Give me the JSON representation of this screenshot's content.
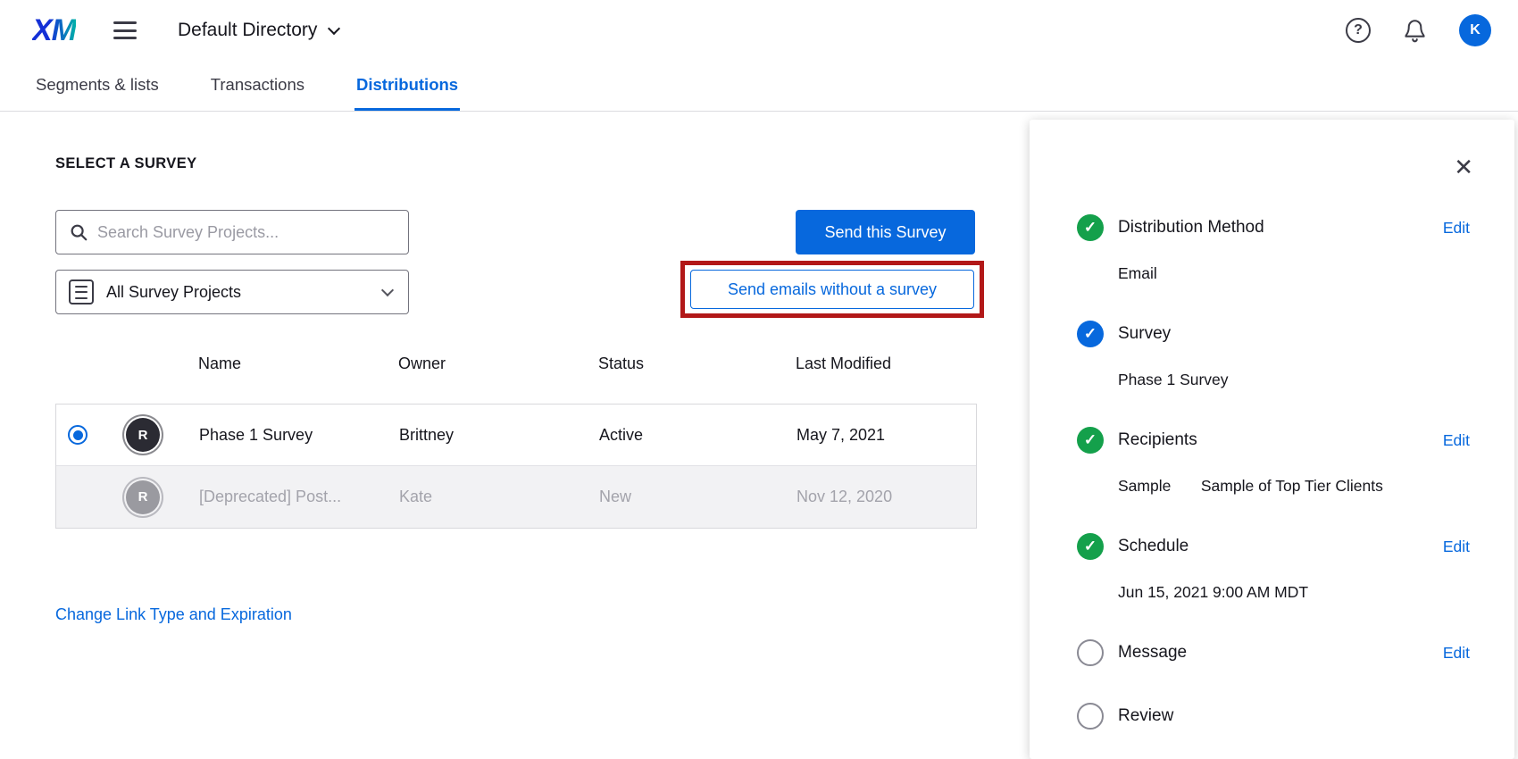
{
  "header": {
    "logo": "XM",
    "directory_label": "Default Directory",
    "avatar_initial": "K",
    "help_glyph": "?"
  },
  "tabs": [
    {
      "label": "Segments & lists"
    },
    {
      "label": "Transactions"
    },
    {
      "label": "Distributions"
    }
  ],
  "main": {
    "section_title": "SELECT A SURVEY",
    "search_placeholder": "Search Survey Projects...",
    "filter_value": "All Survey Projects",
    "send_survey_button": "Send this Survey",
    "send_without_survey_button": "Send emails without a survey",
    "table": {
      "columns": [
        "Name",
        "Owner",
        "Status",
        "Last Modified"
      ],
      "rows": [
        {
          "avatar": "R",
          "name": "Phase 1 Survey",
          "owner": "Brittney",
          "status": "Active",
          "last_modified": "May 7, 2021"
        },
        {
          "avatar": "R",
          "name": "[Deprecated] Post...",
          "owner": "Kate",
          "status": "New",
          "last_modified": "Nov 12, 2020"
        }
      ]
    },
    "change_link": "Change Link Type and Expiration"
  },
  "panel": {
    "close_glyph": "✕",
    "check_glyph": "✓",
    "steps": [
      {
        "label": "Distribution Method",
        "detail": "Email",
        "edit": "Edit"
      },
      {
        "label": "Survey",
        "detail": "Phase 1 Survey"
      },
      {
        "label": "Recipients",
        "detail_primary": "Sample",
        "detail_secondary": "Sample of Top Tier Clients",
        "edit": "Edit"
      },
      {
        "label": "Schedule",
        "detail": "Jun 15, 2021 9:00 AM MDT",
        "edit": "Edit"
      },
      {
        "label": "Message",
        "edit": "Edit"
      },
      {
        "label": "Review"
      }
    ]
  },
  "colors": {
    "accent_blue": "#0768DD",
    "success_green": "#14A04B",
    "annotation_red": "#B21818"
  }
}
